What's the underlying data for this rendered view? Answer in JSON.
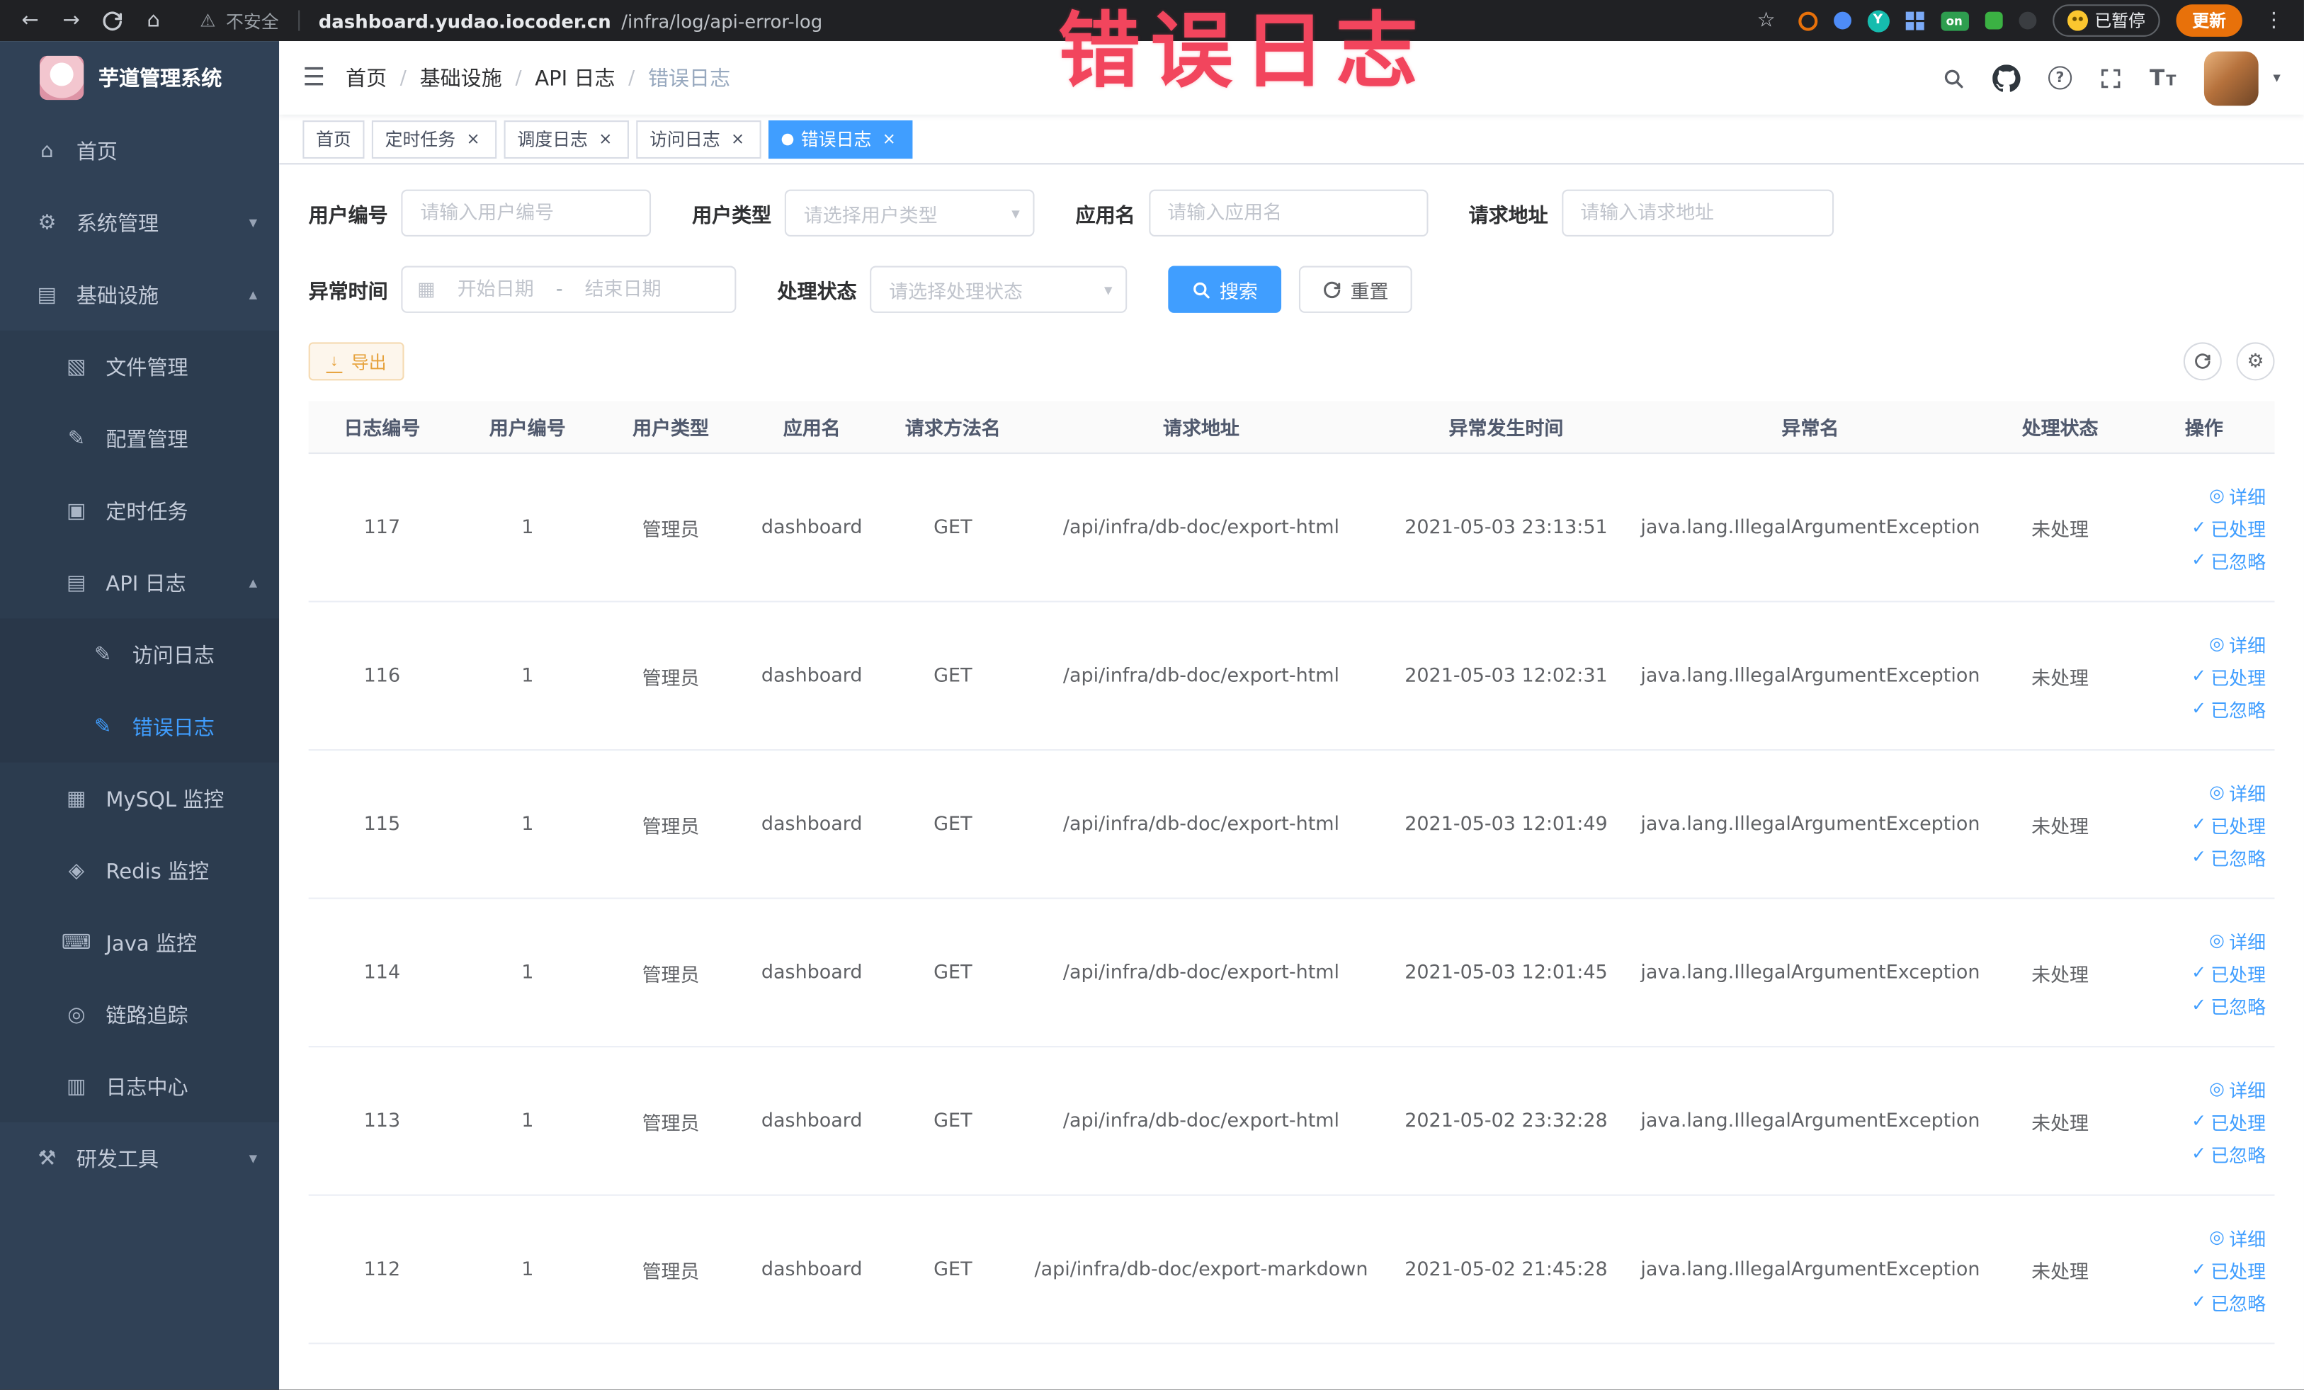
{
  "colors": {
    "accent": "#409eff",
    "sidebar_bg": "#304156",
    "warning": "#e6a23c",
    "annotation": "#f2455d"
  },
  "annotation": {
    "text": "错误日志"
  },
  "browser": {
    "security_label": "不安全",
    "url_domain": "dashboard.yudao.iocoder.cn",
    "url_path": "/infra/log/api-error-log",
    "extension_y_badge": "Y",
    "extension_on_badge": "on",
    "paused_badge": "已暂停",
    "update_button": "更新"
  },
  "sidebar": {
    "logo_title": "芋道管理系统",
    "items": [
      {
        "label": "首页"
      },
      {
        "label": "系统管理"
      },
      {
        "label": "基础设施"
      },
      {
        "label": "文件管理"
      },
      {
        "label": "配置管理"
      },
      {
        "label": "定时任务"
      },
      {
        "label": "API 日志"
      },
      {
        "label": "访问日志"
      },
      {
        "label": "错误日志"
      },
      {
        "label": "MySQL 监控"
      },
      {
        "label": "Redis 监控"
      },
      {
        "label": "Java 监控"
      },
      {
        "label": "链路追踪"
      },
      {
        "label": "日志中心"
      },
      {
        "label": "研发工具"
      }
    ]
  },
  "header": {
    "breadcrumbs": [
      "首页",
      "基础设施",
      "API 日志",
      "错误日志"
    ],
    "breadcrumb_separator": "/"
  },
  "tabs": [
    {
      "label": "首页"
    },
    {
      "label": "定时任务"
    },
    {
      "label": "调度日志"
    },
    {
      "label": "访问日志"
    },
    {
      "label": "错误日志"
    }
  ],
  "filters": {
    "user_id_label": "用户编号",
    "user_id_placeholder": "请输入用户编号",
    "user_type_label": "用户类型",
    "user_type_placeholder": "请选择用户类型",
    "app_name_label": "应用名",
    "app_name_placeholder": "请输入应用名",
    "request_url_label": "请求地址",
    "request_url_placeholder": "请输入请求地址",
    "exception_time_label": "异常时间",
    "start_date_placeholder": "开始日期",
    "end_date_placeholder": "结束日期",
    "range_separator": "-",
    "process_status_label": "处理状态",
    "process_status_placeholder": "请选择处理状态",
    "search_button": "搜索",
    "reset_button": "重置"
  },
  "toolbar": {
    "export_button": "导出"
  },
  "table": {
    "columns": [
      "日志编号",
      "用户编号",
      "用户类型",
      "应用名",
      "请求方法名",
      "请求地址",
      "异常发生时间",
      "异常名",
      "处理状态",
      "操作"
    ],
    "action_labels": {
      "detail": "详细",
      "processed": "已处理",
      "ignored": "已忽略"
    },
    "rows": [
      {
        "id": "117",
        "user_id": "1",
        "user_type": "管理员",
        "app": "dashboard",
        "method": "GET",
        "url": "/api/infra/db-doc/export-html",
        "time": "2021-05-03 23:13:51",
        "exception": "java.lang.IllegalArgumentException",
        "status": "未处理"
      },
      {
        "id": "116",
        "user_id": "1",
        "user_type": "管理员",
        "app": "dashboard",
        "method": "GET",
        "url": "/api/infra/db-doc/export-html",
        "time": "2021-05-03 12:02:31",
        "exception": "java.lang.IllegalArgumentException",
        "status": "未处理"
      },
      {
        "id": "115",
        "user_id": "1",
        "user_type": "管理员",
        "app": "dashboard",
        "method": "GET",
        "url": "/api/infra/db-doc/export-html",
        "time": "2021-05-03 12:01:49",
        "exception": "java.lang.IllegalArgumentException",
        "status": "未处理"
      },
      {
        "id": "114",
        "user_id": "1",
        "user_type": "管理员",
        "app": "dashboard",
        "method": "GET",
        "url": "/api/infra/db-doc/export-html",
        "time": "2021-05-03 12:01:45",
        "exception": "java.lang.IllegalArgumentException",
        "status": "未处理"
      },
      {
        "id": "113",
        "user_id": "1",
        "user_type": "管理员",
        "app": "dashboard",
        "method": "GET",
        "url": "/api/infra/db-doc/export-html",
        "time": "2021-05-02 23:32:28",
        "exception": "java.lang.IllegalArgumentException",
        "status": "未处理"
      },
      {
        "id": "112",
        "user_id": "1",
        "user_type": "管理员",
        "app": "dashboard",
        "method": "GET",
        "url": "/api/infra/db-doc/export-markdown",
        "time": "2021-05-02 21:45:28",
        "exception": "java.lang.IllegalArgumentException",
        "status": "未处理"
      }
    ]
  },
  "icons": {
    "back": "←",
    "forward": "→",
    "home": "⌂",
    "warning": "⚠",
    "star": "☆",
    "kebab": "⋮",
    "hamburger": "☰",
    "close": "×",
    "menu_home": "⌂",
    "menu_system": "⚙",
    "menu_infra": "▤",
    "menu_file": "▧",
    "menu_config": "✎",
    "menu_job": "▣",
    "menu_apilog": "▤",
    "menu_access": "✎",
    "menu_error": "✎",
    "menu_mysql": "▦",
    "menu_redis": "◈",
    "menu_java": "⌨",
    "menu_trace": "◎",
    "menu_logcenter": "▥",
    "menu_devtools": "⚒",
    "chevron_down": "▾",
    "chevron_up": "▴",
    "caret_down": "▾",
    "calendar": "▦",
    "eye": "◎",
    "check": "✓",
    "download": "↓",
    "gear": "⚙",
    "question": "?",
    "size_big": "T",
    "size_small": "T"
  }
}
